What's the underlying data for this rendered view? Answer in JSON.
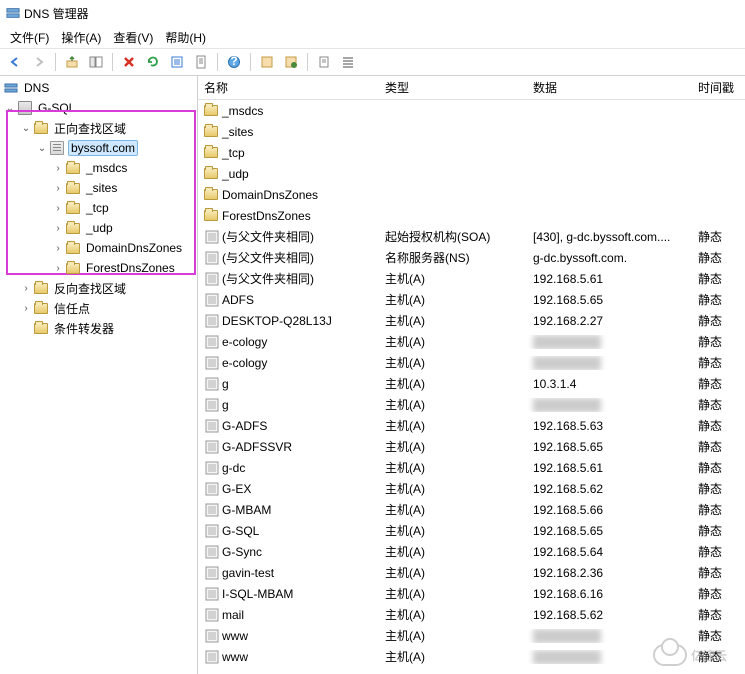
{
  "title": "DNS 管理器",
  "menu": {
    "file": "文件(F)",
    "action": "操作(A)",
    "view": "查看(V)",
    "help": "帮助(H)"
  },
  "tree": {
    "root": "DNS",
    "server": "G-SQL",
    "fwd_zone": "正向查找区域",
    "domain": "byssoft.com",
    "children": [
      "_msdcs",
      "_sites",
      "_tcp",
      "_udp",
      "DomainDnsZones",
      "ForestDnsZones"
    ],
    "rev_zone": "反向查找区域",
    "trust": "信任点",
    "cond_fwd": "条件转发器"
  },
  "columns": {
    "name": "名称",
    "type": "类型",
    "data": "数据",
    "ts": "时间戳"
  },
  "records": [
    {
      "name": "_msdcs",
      "type": "",
      "data": "",
      "ts": "",
      "icon": "folder"
    },
    {
      "name": "_sites",
      "type": "",
      "data": "",
      "ts": "",
      "icon": "folder"
    },
    {
      "name": "_tcp",
      "type": "",
      "data": "",
      "ts": "",
      "icon": "folder"
    },
    {
      "name": "_udp",
      "type": "",
      "data": "",
      "ts": "",
      "icon": "folder"
    },
    {
      "name": "DomainDnsZones",
      "type": "",
      "data": "",
      "ts": "",
      "icon": "folder"
    },
    {
      "name": "ForestDnsZones",
      "type": "",
      "data": "",
      "ts": "",
      "icon": "folder"
    },
    {
      "name": "(与父文件夹相同)",
      "type": "起始授权机构(SOA)",
      "data": "[430], g-dc.byssoft.com....",
      "ts": "静态",
      "icon": "rec"
    },
    {
      "name": "(与父文件夹相同)",
      "type": "名称服务器(NS)",
      "data": "g-dc.byssoft.com.",
      "ts": "静态",
      "icon": "rec"
    },
    {
      "name": "(与父文件夹相同)",
      "type": "主机(A)",
      "data": "192.168.5.61",
      "ts": "静态",
      "icon": "rec"
    },
    {
      "name": "ADFS",
      "type": "主机(A)",
      "data": "192.168.5.65",
      "ts": "静态",
      "icon": "rec"
    },
    {
      "name": "DESKTOP-Q28L13J",
      "type": "主机(A)",
      "data": "192.168.2.27",
      "ts": "静态",
      "icon": "rec"
    },
    {
      "name": "e-cology",
      "type": "主机(A)",
      "data": "",
      "ts": "静态",
      "icon": "rec",
      "blur": true
    },
    {
      "name": "e-cology",
      "type": "主机(A)",
      "data": "",
      "ts": "静态",
      "icon": "rec",
      "blur": true
    },
    {
      "name": "g",
      "type": "主机(A)",
      "data": "10.3.1.4",
      "ts": "静态",
      "icon": "rec"
    },
    {
      "name": "g",
      "type": "主机(A)",
      "data": "",
      "ts": "静态",
      "icon": "rec",
      "blur": true
    },
    {
      "name": "G-ADFS",
      "type": "主机(A)",
      "data": "192.168.5.63",
      "ts": "静态",
      "icon": "rec"
    },
    {
      "name": "G-ADFSSVR",
      "type": "主机(A)",
      "data": "192.168.5.65",
      "ts": "静态",
      "icon": "rec"
    },
    {
      "name": "g-dc",
      "type": "主机(A)",
      "data": "192.168.5.61",
      "ts": "静态",
      "icon": "rec"
    },
    {
      "name": "G-EX",
      "type": "主机(A)",
      "data": "192.168.5.62",
      "ts": "静态",
      "icon": "rec"
    },
    {
      "name": "G-MBAM",
      "type": "主机(A)",
      "data": "192.168.5.66",
      "ts": "静态",
      "icon": "rec"
    },
    {
      "name": "G-SQL",
      "type": "主机(A)",
      "data": "192.168.5.65",
      "ts": "静态",
      "icon": "rec"
    },
    {
      "name": "G-Sync",
      "type": "主机(A)",
      "data": "192.168.5.64",
      "ts": "静态",
      "icon": "rec"
    },
    {
      "name": "gavin-test",
      "type": "主机(A)",
      "data": "192.168.2.36",
      "ts": "静态",
      "icon": "rec"
    },
    {
      "name": "I-SQL-MBAM",
      "type": "主机(A)",
      "data": "192.168.6.16",
      "ts": "静态",
      "icon": "rec"
    },
    {
      "name": "mail",
      "type": "主机(A)",
      "data": "192.168.5.62",
      "ts": "静态",
      "icon": "rec"
    },
    {
      "name": "www",
      "type": "主机(A)",
      "data": "",
      "ts": "静态",
      "icon": "rec",
      "blur": true
    },
    {
      "name": "www",
      "type": "主机(A)",
      "data": "",
      "ts": "静态",
      "icon": "rec",
      "blur": true
    }
  ],
  "watermark": "亿速云"
}
